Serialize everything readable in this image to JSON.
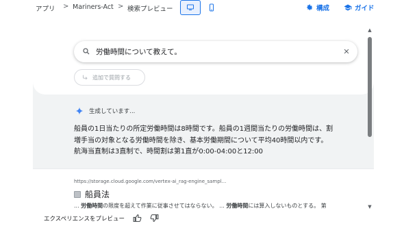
{
  "breadcrumb": {
    "items": [
      "アプリ",
      "Mariners-Act",
      "検索プレビュー"
    ],
    "separator": ">"
  },
  "toolbar": {
    "desktop_view_icon": "desktop-icon",
    "mobile_view_icon": "smartphone-icon",
    "configure_label": "構成",
    "guide_label": "ガイド"
  },
  "search": {
    "query": "労働時間について教えて。",
    "follow_up_placeholder": "追加で質問する"
  },
  "answer": {
    "status": "生成しています...",
    "text": "船員の1日当たりの所定労働時間は8時間です。船員の1週間当たりの労働時間は、割増手当の対象となる労働時間を除き、基本労働期間について平均40時間以内です。航海当直制は3直制で、時間割は第1直が0:00-04:00と12:00"
  },
  "result": {
    "url": "https://storage.cloud.google.com/vertex-ai_rag-engine_sampl...",
    "title": "船員法",
    "snippet_parts": [
      "... ",
      "労働時間",
      "の限度を超えて作業に従事させてはならない。 ... ",
      "労働時間",
      "には算入しないものとする。 第"
    ]
  },
  "footer": {
    "label": "エクスペリエンスをプレビュー",
    "thumbs_up_icon": "thumbs-up-icon",
    "thumbs_down_icon": "thumbs-down-icon"
  },
  "colors": {
    "accent": "#1a73e8",
    "frame_bg": "#f1f3f4",
    "gemini_blue": "#4285f4"
  }
}
